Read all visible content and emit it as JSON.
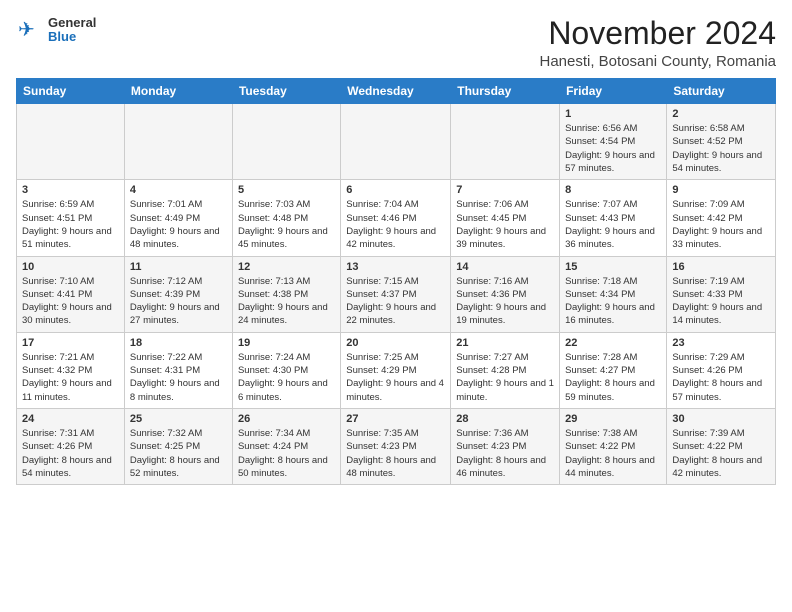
{
  "header": {
    "logo": {
      "general": "General",
      "blue": "Blue"
    },
    "title": "November 2024",
    "subtitle": "Hanesti, Botosani County, Romania"
  },
  "weekdays": [
    "Sunday",
    "Monday",
    "Tuesday",
    "Wednesday",
    "Thursday",
    "Friday",
    "Saturday"
  ],
  "weeks": [
    [
      {
        "day": "",
        "info": ""
      },
      {
        "day": "",
        "info": ""
      },
      {
        "day": "",
        "info": ""
      },
      {
        "day": "",
        "info": ""
      },
      {
        "day": "",
        "info": ""
      },
      {
        "day": "1",
        "info": "Sunrise: 6:56 AM\nSunset: 4:54 PM\nDaylight: 9 hours and 57 minutes."
      },
      {
        "day": "2",
        "info": "Sunrise: 6:58 AM\nSunset: 4:52 PM\nDaylight: 9 hours and 54 minutes."
      }
    ],
    [
      {
        "day": "3",
        "info": "Sunrise: 6:59 AM\nSunset: 4:51 PM\nDaylight: 9 hours and 51 minutes."
      },
      {
        "day": "4",
        "info": "Sunrise: 7:01 AM\nSunset: 4:49 PM\nDaylight: 9 hours and 48 minutes."
      },
      {
        "day": "5",
        "info": "Sunrise: 7:03 AM\nSunset: 4:48 PM\nDaylight: 9 hours and 45 minutes."
      },
      {
        "day": "6",
        "info": "Sunrise: 7:04 AM\nSunset: 4:46 PM\nDaylight: 9 hours and 42 minutes."
      },
      {
        "day": "7",
        "info": "Sunrise: 7:06 AM\nSunset: 4:45 PM\nDaylight: 9 hours and 39 minutes."
      },
      {
        "day": "8",
        "info": "Sunrise: 7:07 AM\nSunset: 4:43 PM\nDaylight: 9 hours and 36 minutes."
      },
      {
        "day": "9",
        "info": "Sunrise: 7:09 AM\nSunset: 4:42 PM\nDaylight: 9 hours and 33 minutes."
      }
    ],
    [
      {
        "day": "10",
        "info": "Sunrise: 7:10 AM\nSunset: 4:41 PM\nDaylight: 9 hours and 30 minutes."
      },
      {
        "day": "11",
        "info": "Sunrise: 7:12 AM\nSunset: 4:39 PM\nDaylight: 9 hours and 27 minutes."
      },
      {
        "day": "12",
        "info": "Sunrise: 7:13 AM\nSunset: 4:38 PM\nDaylight: 9 hours and 24 minutes."
      },
      {
        "day": "13",
        "info": "Sunrise: 7:15 AM\nSunset: 4:37 PM\nDaylight: 9 hours and 22 minutes."
      },
      {
        "day": "14",
        "info": "Sunrise: 7:16 AM\nSunset: 4:36 PM\nDaylight: 9 hours and 19 minutes."
      },
      {
        "day": "15",
        "info": "Sunrise: 7:18 AM\nSunset: 4:34 PM\nDaylight: 9 hours and 16 minutes."
      },
      {
        "day": "16",
        "info": "Sunrise: 7:19 AM\nSunset: 4:33 PM\nDaylight: 9 hours and 14 minutes."
      }
    ],
    [
      {
        "day": "17",
        "info": "Sunrise: 7:21 AM\nSunset: 4:32 PM\nDaylight: 9 hours and 11 minutes."
      },
      {
        "day": "18",
        "info": "Sunrise: 7:22 AM\nSunset: 4:31 PM\nDaylight: 9 hours and 8 minutes."
      },
      {
        "day": "19",
        "info": "Sunrise: 7:24 AM\nSunset: 4:30 PM\nDaylight: 9 hours and 6 minutes."
      },
      {
        "day": "20",
        "info": "Sunrise: 7:25 AM\nSunset: 4:29 PM\nDaylight: 9 hours and 4 minutes."
      },
      {
        "day": "21",
        "info": "Sunrise: 7:27 AM\nSunset: 4:28 PM\nDaylight: 9 hours and 1 minute."
      },
      {
        "day": "22",
        "info": "Sunrise: 7:28 AM\nSunset: 4:27 PM\nDaylight: 8 hours and 59 minutes."
      },
      {
        "day": "23",
        "info": "Sunrise: 7:29 AM\nSunset: 4:26 PM\nDaylight: 8 hours and 57 minutes."
      }
    ],
    [
      {
        "day": "24",
        "info": "Sunrise: 7:31 AM\nSunset: 4:26 PM\nDaylight: 8 hours and 54 minutes."
      },
      {
        "day": "25",
        "info": "Sunrise: 7:32 AM\nSunset: 4:25 PM\nDaylight: 8 hours and 52 minutes."
      },
      {
        "day": "26",
        "info": "Sunrise: 7:34 AM\nSunset: 4:24 PM\nDaylight: 8 hours and 50 minutes."
      },
      {
        "day": "27",
        "info": "Sunrise: 7:35 AM\nSunset: 4:23 PM\nDaylight: 8 hours and 48 minutes."
      },
      {
        "day": "28",
        "info": "Sunrise: 7:36 AM\nSunset: 4:23 PM\nDaylight: 8 hours and 46 minutes."
      },
      {
        "day": "29",
        "info": "Sunrise: 7:38 AM\nSunset: 4:22 PM\nDaylight: 8 hours and 44 minutes."
      },
      {
        "day": "30",
        "info": "Sunrise: 7:39 AM\nSunset: 4:22 PM\nDaylight: 8 hours and 42 minutes."
      }
    ]
  ]
}
